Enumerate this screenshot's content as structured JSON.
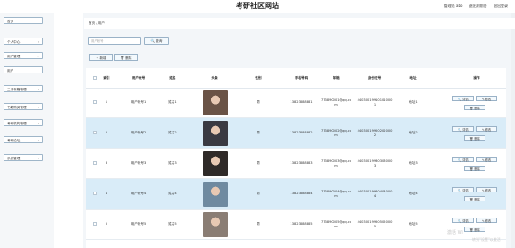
{
  "header": {
    "title": "考研社区网站",
    "links": [
      "管理员 abo",
      "退出到前台",
      "退出登录"
    ]
  },
  "sidebar": {
    "items": [
      {
        "label": "首页",
        "chevron": ""
      },
      {
        "label": "个人中心",
        "chevron": "›"
      },
      {
        "label": "用户管理",
        "chevron": "⌄"
      },
      {
        "label": "用户",
        "chevron": ""
      },
      {
        "label": "二手书籍管理",
        "chevron": "›"
      },
      {
        "label": "书籍购买管理",
        "chevron": "›"
      },
      {
        "label": "考研机构管理",
        "chevron": "›"
      },
      {
        "label": "考研论坛",
        "chevron": "›"
      },
      {
        "label": "系统管理",
        "chevron": "›"
      }
    ]
  },
  "breadcrumb": {
    "text": "首页 / 用户"
  },
  "search": {
    "placeholder": "用户帐号",
    "button": "🔍 查询"
  },
  "toolbar": {
    "add": "+ 新增",
    "delete": "🗑 删除"
  },
  "table": {
    "headers": [
      "索引",
      "用户帐号",
      "姓名",
      "头像",
      "性别",
      "手机号码",
      "邮箱",
      "身份证号",
      "地址",
      "操作"
    ],
    "rows": [
      {
        "index": "1",
        "account": "用户帐号1",
        "name": "姓名1",
        "gender": "男",
        "phone": "13823888881",
        "email": "773890001@qq.com",
        "idcard": "440300199101010001",
        "address": "地址1",
        "avatar_color": "#6a5346"
      },
      {
        "index": "2",
        "account": "用户帐号2",
        "name": "姓名2",
        "gender": "男",
        "phone": "13823888882",
        "email": "773890002@qq.com",
        "idcard": "440300199202020002",
        "address": "地址2",
        "avatar_color": "#3a3a42"
      },
      {
        "index": "3",
        "account": "用户帐号3",
        "name": "姓名3",
        "gender": "男",
        "phone": "13823888883",
        "email": "773890003@qq.com",
        "idcard": "440300199303030003",
        "address": "地址3",
        "avatar_color": "#2f2a28"
      },
      {
        "index": "4",
        "account": "用户帐号4",
        "name": "姓名4",
        "gender": "男",
        "phone": "13823888884",
        "email": "773890004@qq.com",
        "idcard": "440300199404040004",
        "address": "地址4",
        "avatar_color": "#6f8aa0"
      },
      {
        "index": "5",
        "account": "用户帐号5",
        "name": "姓名5",
        "gender": "男",
        "phone": "13823888885",
        "email": "773890005@qq.com",
        "idcard": "440300199505050005",
        "address": "地址5",
        "avatar_color": "#8a7d74"
      }
    ],
    "actions": {
      "detail": "🔍 详情",
      "edit": "✎ 修改",
      "delete": "🗑 删除"
    }
  },
  "watermark": {
    "line1": "激活 Wi",
    "line2": "转到\"设置\"以激活"
  }
}
